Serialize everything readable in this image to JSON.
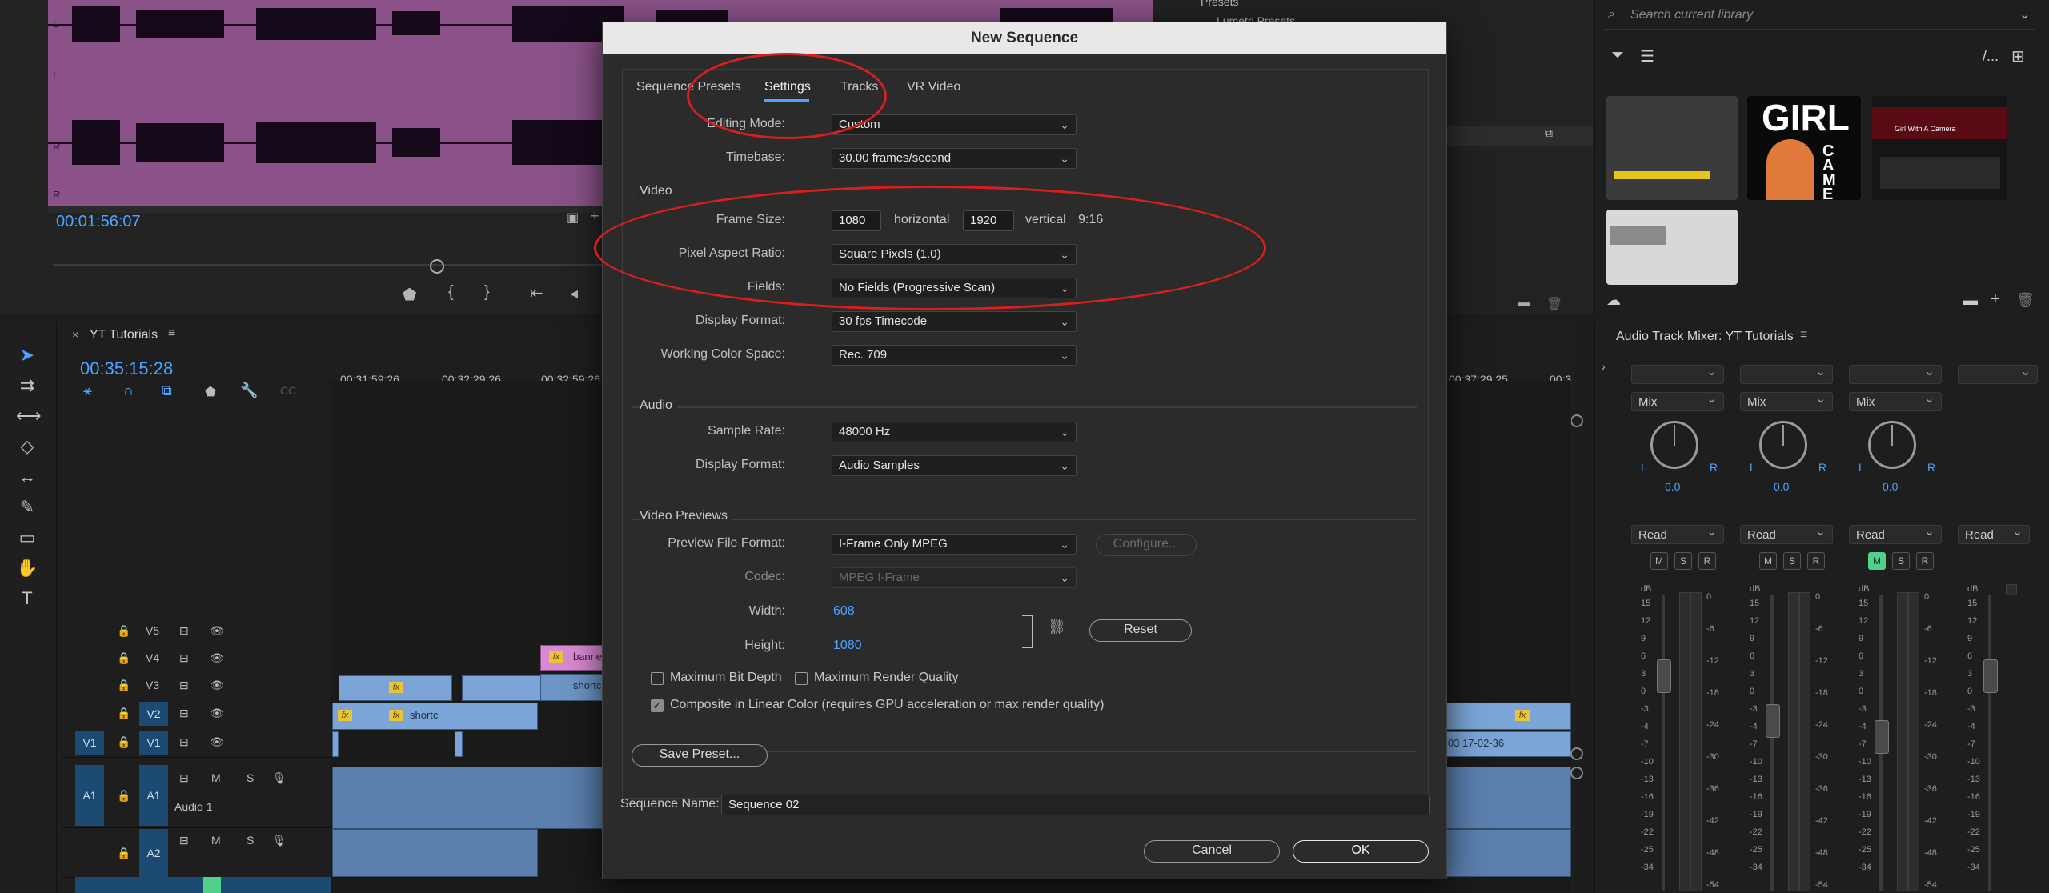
{
  "source": {
    "channel_labels": [
      "L",
      "L",
      "R",
      "R"
    ],
    "timecode": "00:01:56:07"
  },
  "project": {
    "presets_label": "Presets",
    "lumetri_label": "Lumetri Presets"
  },
  "timeline": {
    "tab_label": "YT Tutorials",
    "timecode": "00:35:15:28",
    "ruler": [
      "00:31:59:26",
      "00:32:29:26",
      "00:32:59:26",
      "00:37:29:25",
      "00:3"
    ],
    "tracks": {
      "v5": "V5",
      "v4": "V4",
      "v3": "V3",
      "v2": "V2",
      "v1": "V1",
      "v1_src": "V1",
      "a1": "A1",
      "a1_src": "A1",
      "a1_name": "Audio 1",
      "a2": "A2",
      "m": "M",
      "s": "S"
    },
    "clips": {
      "banner": "banne",
      "shortc_v3": "shortc",
      "shortc_v2": "shortc",
      "date_clip": "03 17-02-36",
      "fx": "fx"
    }
  },
  "library": {
    "search_placeholder": "Search current library",
    "thumb_title": "Girl With A Camera",
    "girl_text": "GIRL",
    "camera_text": "CAMERA"
  },
  "mixer": {
    "title": "Audio Track Mixer: YT Tutorials",
    "mix": "Mix",
    "pan_value": "0.0",
    "read": "Read",
    "m": "M",
    "s": "S",
    "r": "R",
    "l": "L",
    "rr": "R",
    "db": "dB",
    "left_scale": [
      "15",
      "12",
      "9",
      "6",
      "3",
      "0",
      "-3",
      "-4",
      "-7",
      "-10",
      "-13",
      "-16",
      "-19",
      "-22",
      "-25",
      "-34"
    ],
    "right_scale": [
      "0",
      "-6",
      "-12",
      "-18",
      "-24",
      "-30",
      "-36",
      "-42",
      "-48",
      "-54"
    ]
  },
  "dialog": {
    "title": "New Sequence",
    "tabs": [
      "Sequence Presets",
      "Settings",
      "Tracks",
      "VR Video"
    ],
    "editing_mode_label": "Editing Mode:",
    "editing_mode": "Custom",
    "timebase_label": "Timebase:",
    "timebase": "30.00  frames/second",
    "video_section": "Video",
    "frame_size_label": "Frame Size:",
    "frame_width": "1080",
    "horizontal": "horizontal",
    "frame_height": "1920",
    "vertical": "vertical",
    "aspect": "9:16",
    "par_label": "Pixel Aspect Ratio:",
    "par": "Square Pixels (1.0)",
    "fields_label": "Fields:",
    "fields": "No Fields (Progressive Scan)",
    "display_format_label": "Display Format:",
    "display_format": "30 fps Timecode",
    "color_space_label": "Working Color Space:",
    "color_space": "Rec. 709",
    "audio_section": "Audio",
    "sample_rate_label": "Sample Rate:",
    "sample_rate": "48000 Hz",
    "audio_display_label": "Display Format:",
    "audio_display": "Audio Samples",
    "previews_section": "Video Previews",
    "preview_format_label": "Preview File Format:",
    "preview_format": "I-Frame Only MPEG",
    "configure": "Configure...",
    "codec_label": "Codec:",
    "codec": "MPEG I-Frame",
    "width_label": "Width:",
    "width": "608",
    "height_label": "Height:",
    "height": "1080",
    "reset": "Reset",
    "max_bit_depth": "Maximum Bit Depth",
    "max_render_quality": "Maximum Render Quality",
    "composite_linear": "Composite in Linear Color (requires GPU acceleration or max render quality)",
    "save_preset": "Save Preset...",
    "sequence_name_label": "Sequence Name:",
    "sequence_name": "Sequence 02",
    "cancel": "Cancel",
    "ok": "OK"
  },
  "colors": {
    "accent": "#4da3ff",
    "annotation_red": "#d81f1f",
    "waveform_bg": "#8a5288",
    "video_clip": "#7aa5d6"
  }
}
